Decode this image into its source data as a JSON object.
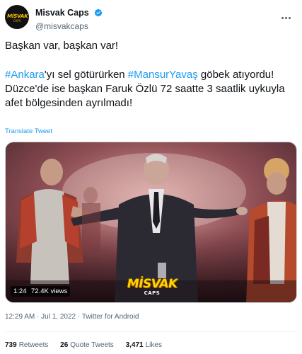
{
  "author": {
    "display_name": "Misvak Caps",
    "handle": "@misvakcaps",
    "avatar_logo_text": "MİSVAK",
    "avatar_logo_sub": "CAPS"
  },
  "tweet": {
    "line1": "Başkan var, başkan var!",
    "hashtag1": "#Ankara",
    "text_after_hashtag1": "'yı sel götürürken ",
    "hashtag2": "#MansurYavaş",
    "text_after_hashtag2": " göbek atıyordu!",
    "line3": "Düzce'de ise başkan Faruk Özlü 72 saatte 3 saatlik uykuyla afet bölgesinden ayrılmadı!",
    "translate_label": "Translate Tweet"
  },
  "video": {
    "duration": "1:24",
    "views": "72.4K views",
    "watermark_main": "MİSVAK",
    "watermark_sub": "CAPS"
  },
  "meta": {
    "time": "12:29 AM",
    "separator": " · ",
    "date": "Jul 1, 2022",
    "source": "Twitter for Android"
  },
  "stats": {
    "retweets_count": "739",
    "retweets_label": "Retweets",
    "quotes_count": "26",
    "quotes_label": "Quote Tweets",
    "likes_count": "3,471",
    "likes_label": "Likes"
  },
  "colors": {
    "link": "#1d9bf0",
    "text": "#0f1419",
    "secondary": "#536471",
    "verified": "#1d9bf0"
  },
  "icons": [
    "verified-badge-icon",
    "more-options-icon"
  ]
}
